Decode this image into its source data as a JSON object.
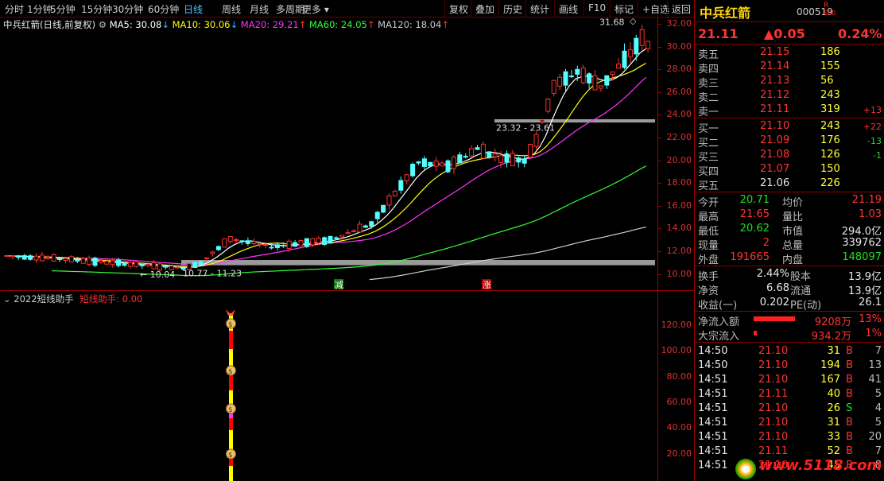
{
  "toolbar": {
    "periods": [
      "分时",
      "1分钟",
      "5分钟",
      "15分钟",
      "30分钟",
      "60分钟",
      "日线",
      "周线",
      "月线",
      "多周期",
      "更多"
    ],
    "active_period": "日线",
    "actions": [
      "复权",
      "叠加",
      "历史",
      "统计",
      "画线",
      "F10",
      "标记",
      "+自选",
      "返回"
    ]
  },
  "chart_header": {
    "name": "中兵红箭",
    "mode": "(日线,前复权)",
    "ma": [
      {
        "label": "MA5: 30.08",
        "arrow": "↓",
        "color": "#ffffff"
      },
      {
        "label": "MA10: 30.06",
        "arrow": "↓",
        "color": "#ffff00"
      },
      {
        "label": "MA20: 29.21",
        "arrow": "↑",
        "color": "#ff33ff"
      },
      {
        "label": "MA60: 24.05",
        "arrow": "↑",
        "color": "#33ff33"
      },
      {
        "label": "MA120: 18.04",
        "arrow": "↑",
        "color": "#cccccc"
      }
    ]
  },
  "price_axis": [
    "32.00",
    "30.00",
    "28.00",
    "26.00",
    "24.00",
    "22.00",
    "20.00",
    "18.00",
    "16.00",
    "14.00",
    "12.00",
    "10.00"
  ],
  "chart_annotations": {
    "high_label": "31.68",
    "low_label": "10.04",
    "band_low": "10.77 - 11.23",
    "band_mid": "23.32 - 23.61",
    "tag_reduce": "减",
    "tag_rise": "涨"
  },
  "indicator": {
    "title": "2022短线助手",
    "sub_label": "短线助手: 0.00",
    "axis": [
      "120.00",
      "100.00",
      "80.00",
      "60.00",
      "40.00",
      "20.00"
    ]
  },
  "quote": {
    "name": "中兵红箭",
    "code": "000519",
    "flag_r": "R",
    "flag_num": "500",
    "price": "21.11",
    "change": "▲0.05",
    "change_pct": "0.24%",
    "sell": [
      {
        "label": "卖五",
        "price": "21.15",
        "vol": "186",
        "chg": ""
      },
      {
        "label": "卖四",
        "price": "21.14",
        "vol": "155",
        "chg": ""
      },
      {
        "label": "卖三",
        "price": "21.13",
        "vol": "56",
        "chg": ""
      },
      {
        "label": "卖二",
        "price": "21.12",
        "vol": "243",
        "chg": ""
      },
      {
        "label": "卖一",
        "price": "21.11",
        "vol": "319",
        "chg": "+13"
      }
    ],
    "buy": [
      {
        "label": "买一",
        "price": "21.10",
        "vol": "243",
        "chg": "+22",
        "chgc": "red"
      },
      {
        "label": "买二",
        "price": "21.09",
        "vol": "176",
        "chg": "-13",
        "chgc": "green"
      },
      {
        "label": "买三",
        "price": "21.08",
        "vol": "126",
        "chg": "-1",
        "chgc": "green"
      },
      {
        "label": "买四",
        "price": "21.07",
        "vol": "150",
        "chg": "",
        "chgc": "red"
      },
      {
        "label": "买五",
        "price": "21.06",
        "vol": "226",
        "chg": "",
        "chgc": "red"
      }
    ],
    "stats": [
      {
        "l1": "今开",
        "v1": "20.71",
        "c1": "green",
        "l2": "均价",
        "v2": "21.19",
        "c2": "red"
      },
      {
        "l1": "最高",
        "v1": "21.65",
        "c1": "red",
        "l2": "量比",
        "v2": "1.03",
        "c2": "red"
      },
      {
        "l1": "最低",
        "v1": "20.62",
        "c1": "green",
        "l2": "市值",
        "v2": "294.0亿",
        "c2": "white"
      },
      {
        "l1": "现量",
        "v1": "2",
        "c1": "red",
        "l2": "总量",
        "v2": "339762",
        "c2": "white"
      },
      {
        "l1": "外盘",
        "v1": "191665",
        "c1": "red",
        "l2": "内盘",
        "v2": "148097",
        "c2": "green"
      }
    ],
    "fund": [
      {
        "l1": "换手",
        "v1": "2.44%",
        "l2": "股本",
        "v2": "13.9亿"
      },
      {
        "l1": "净资",
        "v1": "6.68",
        "l2": "流通",
        "v2": "13.9亿"
      },
      {
        "l1": "收益(一)",
        "v1": "0.202",
        "l2": "PE(动)",
        "v2": "26.1"
      }
    ],
    "flow": [
      {
        "label": "净流入额",
        "value": "9208万",
        "pct": "13%"
      },
      {
        "label": "大宗流入",
        "value": "934.2万",
        "pct": "1%"
      }
    ],
    "ticks": [
      {
        "t": "14:50",
        "p": "21.10",
        "v": "31",
        "d": "B",
        "n": "7"
      },
      {
        "t": "14:50",
        "p": "21.10",
        "v": "194",
        "d": "B",
        "n": "13"
      },
      {
        "t": "14:51",
        "p": "21.10",
        "v": "167",
        "d": "B",
        "n": "41"
      },
      {
        "t": "14:51",
        "p": "21.11",
        "v": "40",
        "d": "B",
        "n": "5"
      },
      {
        "t": "14:51",
        "p": "21.10",
        "v": "26",
        "d": "S",
        "n": "4"
      },
      {
        "t": "14:51",
        "p": "21.10",
        "v": "31",
        "d": "B",
        "n": "5"
      },
      {
        "t": "14:51",
        "p": "21.10",
        "v": "33",
        "d": "B",
        "n": "20"
      },
      {
        "t": "14:51",
        "p": "21.11",
        "v": "52",
        "d": "B",
        "n": "7"
      },
      {
        "t": "14:51",
        "p": "21.10",
        "v": "45",
        "d": "B",
        "n": "8"
      }
    ]
  },
  "watermark": "www.5118.com"
}
